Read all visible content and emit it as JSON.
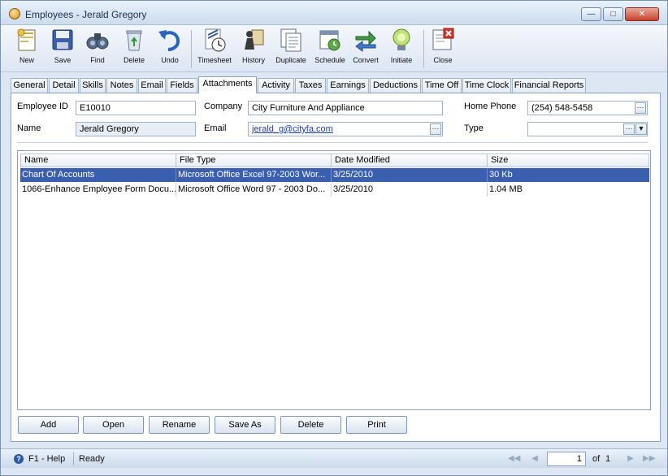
{
  "window": {
    "title": "Employees - Jerald Gregory"
  },
  "toolbar": {
    "new": "New",
    "save": "Save",
    "find": "Find",
    "delete": "Delete",
    "undo": "Undo",
    "timesheet": "Timesheet",
    "history": "History",
    "duplicate": "Duplicate",
    "schedule": "Schedule",
    "convert": "Convert",
    "initiate": "Initiate",
    "close": "Close"
  },
  "tabs": [
    "General",
    "Detail",
    "Skills",
    "Notes",
    "Email",
    "Fields",
    "Attachments",
    "Activity",
    "Taxes",
    "Earnings",
    "Deductions",
    "Time Off",
    "Time Clock",
    "Financial Reports"
  ],
  "form": {
    "employee_id_label": "Employee ID",
    "employee_id": "E10010",
    "name_label": "Name",
    "name": "Jerald Gregory",
    "company_label": "Company",
    "company": "City Furniture And Appliance",
    "email_label": "Email",
    "email": "jerald_g@cityfa.com",
    "home_phone_label": "Home Phone",
    "home_phone": "(254) 548-5458",
    "type_label": "Type",
    "type": ""
  },
  "grid": {
    "columns": [
      "Name",
      "File Type",
      "Date Modified",
      "Size"
    ],
    "rows": [
      {
        "name": "Chart Of Accounts",
        "file_type": "Microsoft Office Excel 97-2003 Wor...",
        "date": "3/25/2010",
        "size": "30 Kb"
      },
      {
        "name": "1066-Enhance Employee Form Docu...",
        "file_type": "Microsoft Office Word 97 - 2003 Do...",
        "date": "3/25/2010",
        "size": "1.04 MB"
      }
    ]
  },
  "actions": {
    "add": "Add",
    "open": "Open",
    "rename": "Rename",
    "save_as": "Save As",
    "delete": "Delete",
    "print": "Print"
  },
  "status": {
    "help": "F1 - Help",
    "state": "Ready",
    "page": "1",
    "of_label": "of",
    "total": "1"
  }
}
